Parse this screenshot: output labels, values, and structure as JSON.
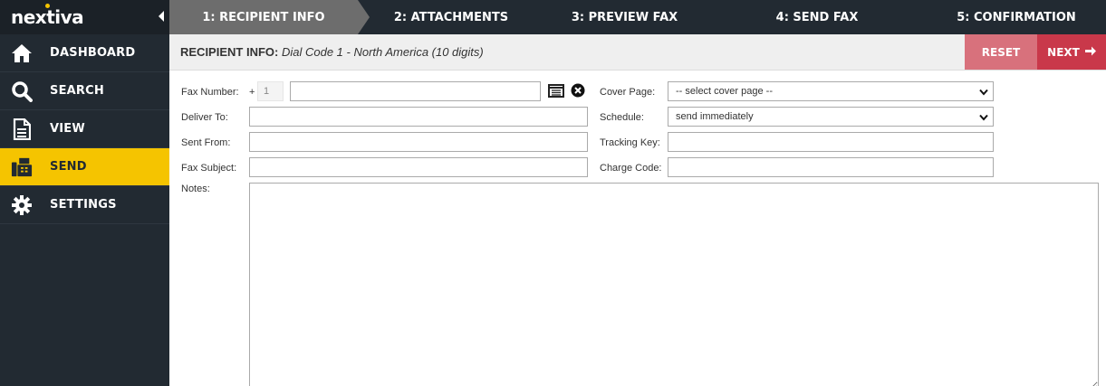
{
  "brand": {
    "logo_text": "nextiva",
    "accent": "#f5c400"
  },
  "sidebar": {
    "items": [
      {
        "label": "DASHBOARD",
        "icon": "home-icon"
      },
      {
        "label": "SEARCH",
        "icon": "search-icon"
      },
      {
        "label": "VIEW",
        "icon": "document-icon"
      },
      {
        "label": "SEND",
        "icon": "fax-icon",
        "active": true
      },
      {
        "label": "SETTINGS",
        "icon": "gear-icon"
      }
    ]
  },
  "steps": [
    {
      "label": "1: RECIPIENT INFO",
      "active": true
    },
    {
      "label": "2: ATTACHMENTS"
    },
    {
      "label": "3: PREVIEW FAX"
    },
    {
      "label": "4: SEND FAX"
    },
    {
      "label": "5: CONFIRMATION"
    }
  ],
  "header": {
    "title": "RECIPIENT INFO:",
    "subtitle": "Dial Code 1 - North America (10 digits)",
    "reset_label": "RESET",
    "next_label": "NEXT"
  },
  "form": {
    "fax_number_label": "Fax Number:",
    "plus_sign": "+",
    "dial_code_value": "1",
    "fax_number_value": "",
    "deliver_to_label": "Deliver To:",
    "deliver_to_value": "",
    "sent_from_label": "Sent From:",
    "sent_from_value": "",
    "fax_subject_label": "Fax Subject:",
    "fax_subject_value": "",
    "notes_label": "Notes:",
    "cover_page_label": "Cover Page:",
    "cover_page_value": "-- select cover page --",
    "schedule_label": "Schedule:",
    "schedule_value": "send immediately",
    "tracking_key_label": "Tracking Key:",
    "tracking_key_value": "",
    "charge_code_label": "Charge Code:",
    "charge_code_value": ""
  }
}
